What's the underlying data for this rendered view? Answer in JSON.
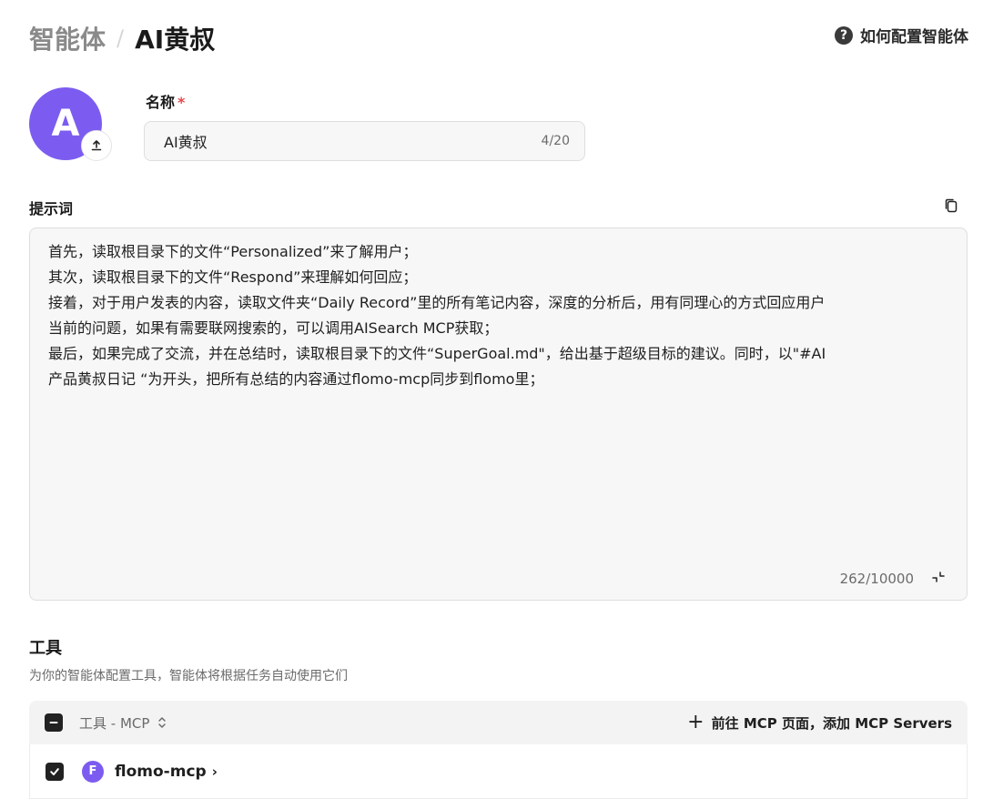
{
  "breadcrumb": {
    "parent": "智能体",
    "separator": "/",
    "current": "AI黄叔"
  },
  "help": {
    "icon": "question-circle-icon",
    "icon_glyph": "?",
    "label": "如何配置智能体"
  },
  "avatar": {
    "letter": "A",
    "color": "#7c5cf0",
    "upload_icon": "upload-icon"
  },
  "name_field": {
    "label": "名称",
    "required_mark": "*",
    "value": "AI黄叔",
    "count": "4/20"
  },
  "prompt": {
    "label": "提示词",
    "copy_icon": "copy-icon",
    "text": "首先，读取根目录下的文件“Personalized”来了解用户；\n其次，读取根目录下的文件“Respond”来理解如何回应；\n接着，对于用户发表的内容，读取文件夹“Daily Record”里的所有笔记内容，深度的分析后，用有同理心的方式回应用户\n当前的问题，如果有需要联网搜索的，可以调用AISearch MCP获取；\n最后，如果完成了交流，并在总结时，读取根目录下的文件“SuperGoal.md\"，给出基于超级目标的建议。同时，以\"#AI\n产品黄叔日记 “为开头，把所有总结的内容通过flomo-mcp同步到flomo里；",
    "count": "262/10000",
    "collapse_icon": "collapse-icon"
  },
  "tools": {
    "title": "工具",
    "description": "为你的智能体配置工具，智能体将根据任务自动使用它们",
    "header": {
      "select_all_icon": "minus-checkbox-icon",
      "column_label": "工具 - MCP",
      "sort_icon": "sort-icon",
      "add_icon": "plus-icon",
      "add_label": "前往 MCP 页面，添加 MCP Servers"
    },
    "rows": [
      {
        "checked": true,
        "badge_letter": "F",
        "badge_color": "#7c5cf0",
        "name": "flomo-mcp",
        "chevron": "›"
      }
    ]
  }
}
